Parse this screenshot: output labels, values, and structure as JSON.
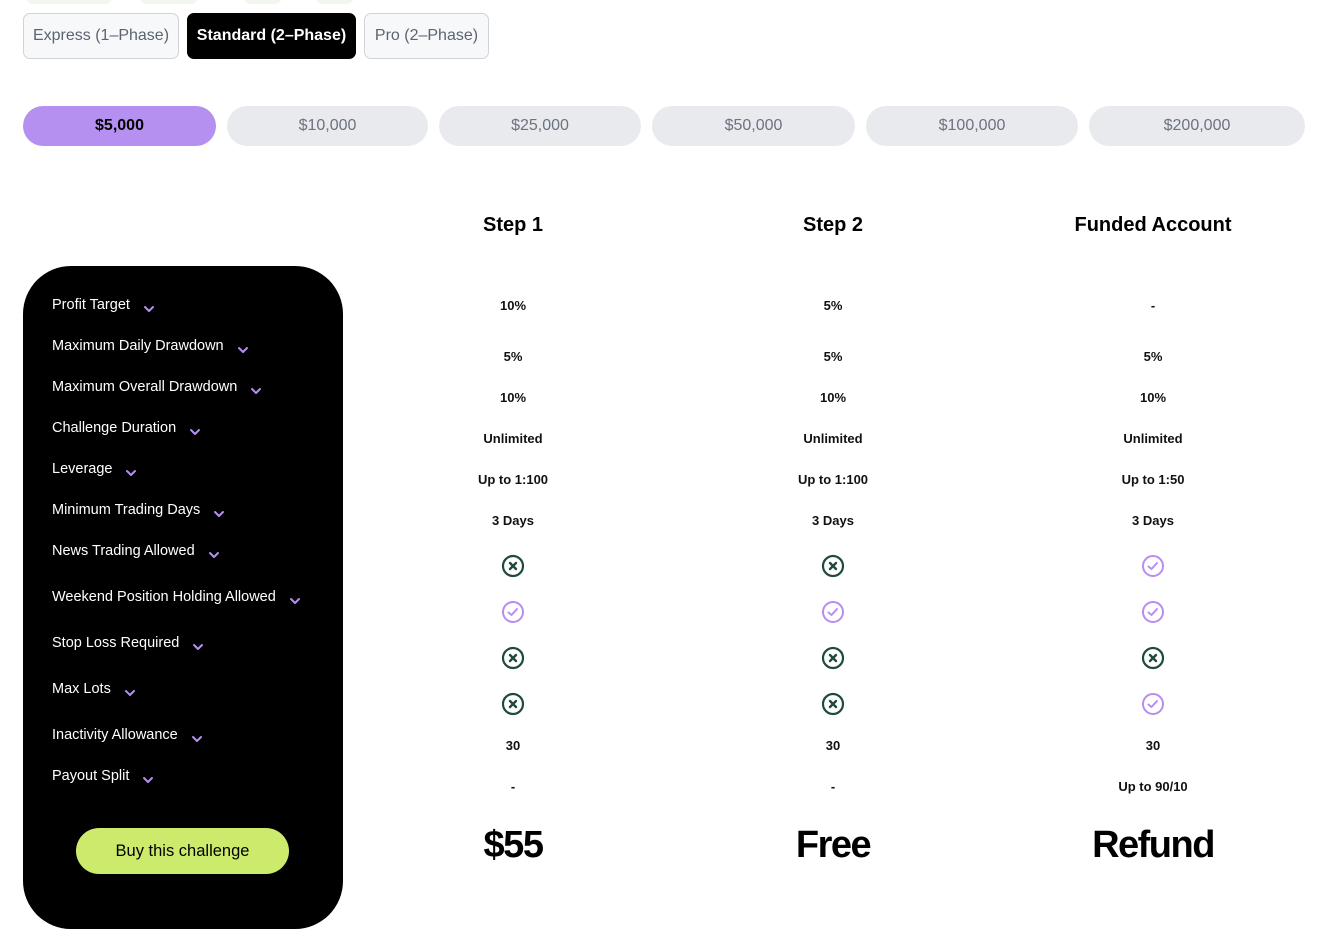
{
  "phase_tabs": [
    {
      "label": "Express (1–Phase)",
      "active": false
    },
    {
      "label": "Standard (2–Phase)",
      "active": true
    },
    {
      "label": "Pro (2–Phase)",
      "active": false
    }
  ],
  "account_sizes": [
    {
      "label": "$5,000",
      "active": true
    },
    {
      "label": "$10,000",
      "active": false
    },
    {
      "label": "$25,000",
      "active": false
    },
    {
      "label": "$50,000",
      "active": false
    },
    {
      "label": "$100,000",
      "active": false
    },
    {
      "label": "$200,000",
      "active": false
    }
  ],
  "columns": [
    "Step 1",
    "Step 2",
    "Funded Account"
  ],
  "features": [
    {
      "label": "Profit Target",
      "values": [
        "10%",
        "5%",
        "-"
      ]
    },
    {
      "label": "Maximum Daily Drawdown",
      "values": [
        "5%",
        "5%",
        "5%"
      ]
    },
    {
      "label": "Maximum Overall Drawdown",
      "values": [
        "10%",
        "10%",
        "10%"
      ]
    },
    {
      "label": "Challenge Duration",
      "values": [
        "Unlimited",
        "Unlimited",
        "Unlimited"
      ]
    },
    {
      "label": "Leverage",
      "values": [
        "Up to 1:100",
        "Up to 1:100",
        "Up to 1:50"
      ]
    },
    {
      "label": "Minimum Trading Days",
      "values": [
        "3 Days",
        "3 Days",
        "3 Days"
      ]
    },
    {
      "label": "News Trading Allowed",
      "values": [
        "x-icon",
        "x-icon",
        "check-icon"
      ]
    },
    {
      "label": "Weekend Position Holding Allowed",
      "values": [
        "check-icon",
        "check-icon",
        "check-icon"
      ]
    },
    {
      "label": "Stop Loss Required",
      "values": [
        "x-icon",
        "x-icon",
        "x-icon"
      ]
    },
    {
      "label": "Max Lots",
      "values": [
        "x-icon",
        "x-icon",
        "check-icon"
      ]
    },
    {
      "label": "Inactivity Allowance",
      "values": [
        "30",
        "30",
        "30"
      ]
    },
    {
      "label": "Payout Split",
      "values": [
        "-",
        "-",
        "Up to 90/10"
      ]
    }
  ],
  "prices": [
    "$55",
    "Free",
    "Refund"
  ],
  "buy_button": "Buy this challenge",
  "colors": {
    "accent_purple": "#b590f0",
    "check_purple": "#b98cf2",
    "x_dark_green": "#1f4a3a",
    "buy_green": "#ccea6c"
  }
}
